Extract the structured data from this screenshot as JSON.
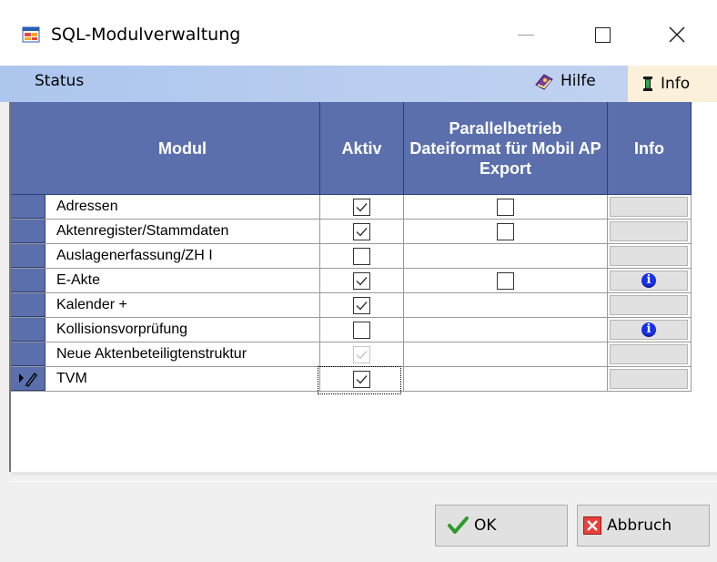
{
  "window": {
    "title": "SQL-Modulverwaltung",
    "minimize_glyph": "—",
    "close_glyph": "✕"
  },
  "menu": {
    "status_label": "Status",
    "help_label": "Hilfe",
    "info_label": "Info"
  },
  "grid": {
    "headers": {
      "modul": "Modul",
      "aktiv": "Aktiv",
      "parallel": "Parallelbetrieb Dateiformat für Mobil AP Export",
      "info": "Info"
    },
    "rows": [
      {
        "modul": "Adressen",
        "aktiv": true,
        "parallel": false,
        "has_parallel": true,
        "info": false
      },
      {
        "modul": "Aktenregister/Stammdaten",
        "aktiv": true,
        "parallel": false,
        "has_parallel": true,
        "info": false
      },
      {
        "modul": "Auslagenerfassung/ZH I",
        "aktiv": false,
        "has_parallel": false,
        "info": false
      },
      {
        "modul": "E-Akte",
        "aktiv": true,
        "parallel": false,
        "has_parallel": true,
        "info": true
      },
      {
        "modul": "Kalender +",
        "aktiv": true,
        "has_parallel": false,
        "info": false
      },
      {
        "modul": "Kollisionsvorprüfung",
        "aktiv": false,
        "has_parallel": false,
        "info": true
      },
      {
        "modul": "Neue Aktenbeteiligtenstruktur",
        "aktiv": true,
        "aktiv_disabled": true,
        "has_parallel": false,
        "info": false
      },
      {
        "modul": "TVM",
        "aktiv": true,
        "aktiv_focused": true,
        "has_parallel": false,
        "info": false,
        "current": true
      }
    ]
  },
  "buttons": {
    "ok_label": "OK",
    "cancel_label": "Abbruch"
  },
  "colors": {
    "header_bg": "#5a6fac",
    "menubar_bg": "#adc6ee",
    "info_menu_bg": "#fbf0d9",
    "info_icon": "#1830e8"
  },
  "icons": {
    "app": "app-window-icon",
    "help": "help-book-icon",
    "info": "info-i-icon",
    "ok": "checkmark-icon",
    "cancel": "cancel-x-icon",
    "current_row": "edit-pencil-icon"
  }
}
